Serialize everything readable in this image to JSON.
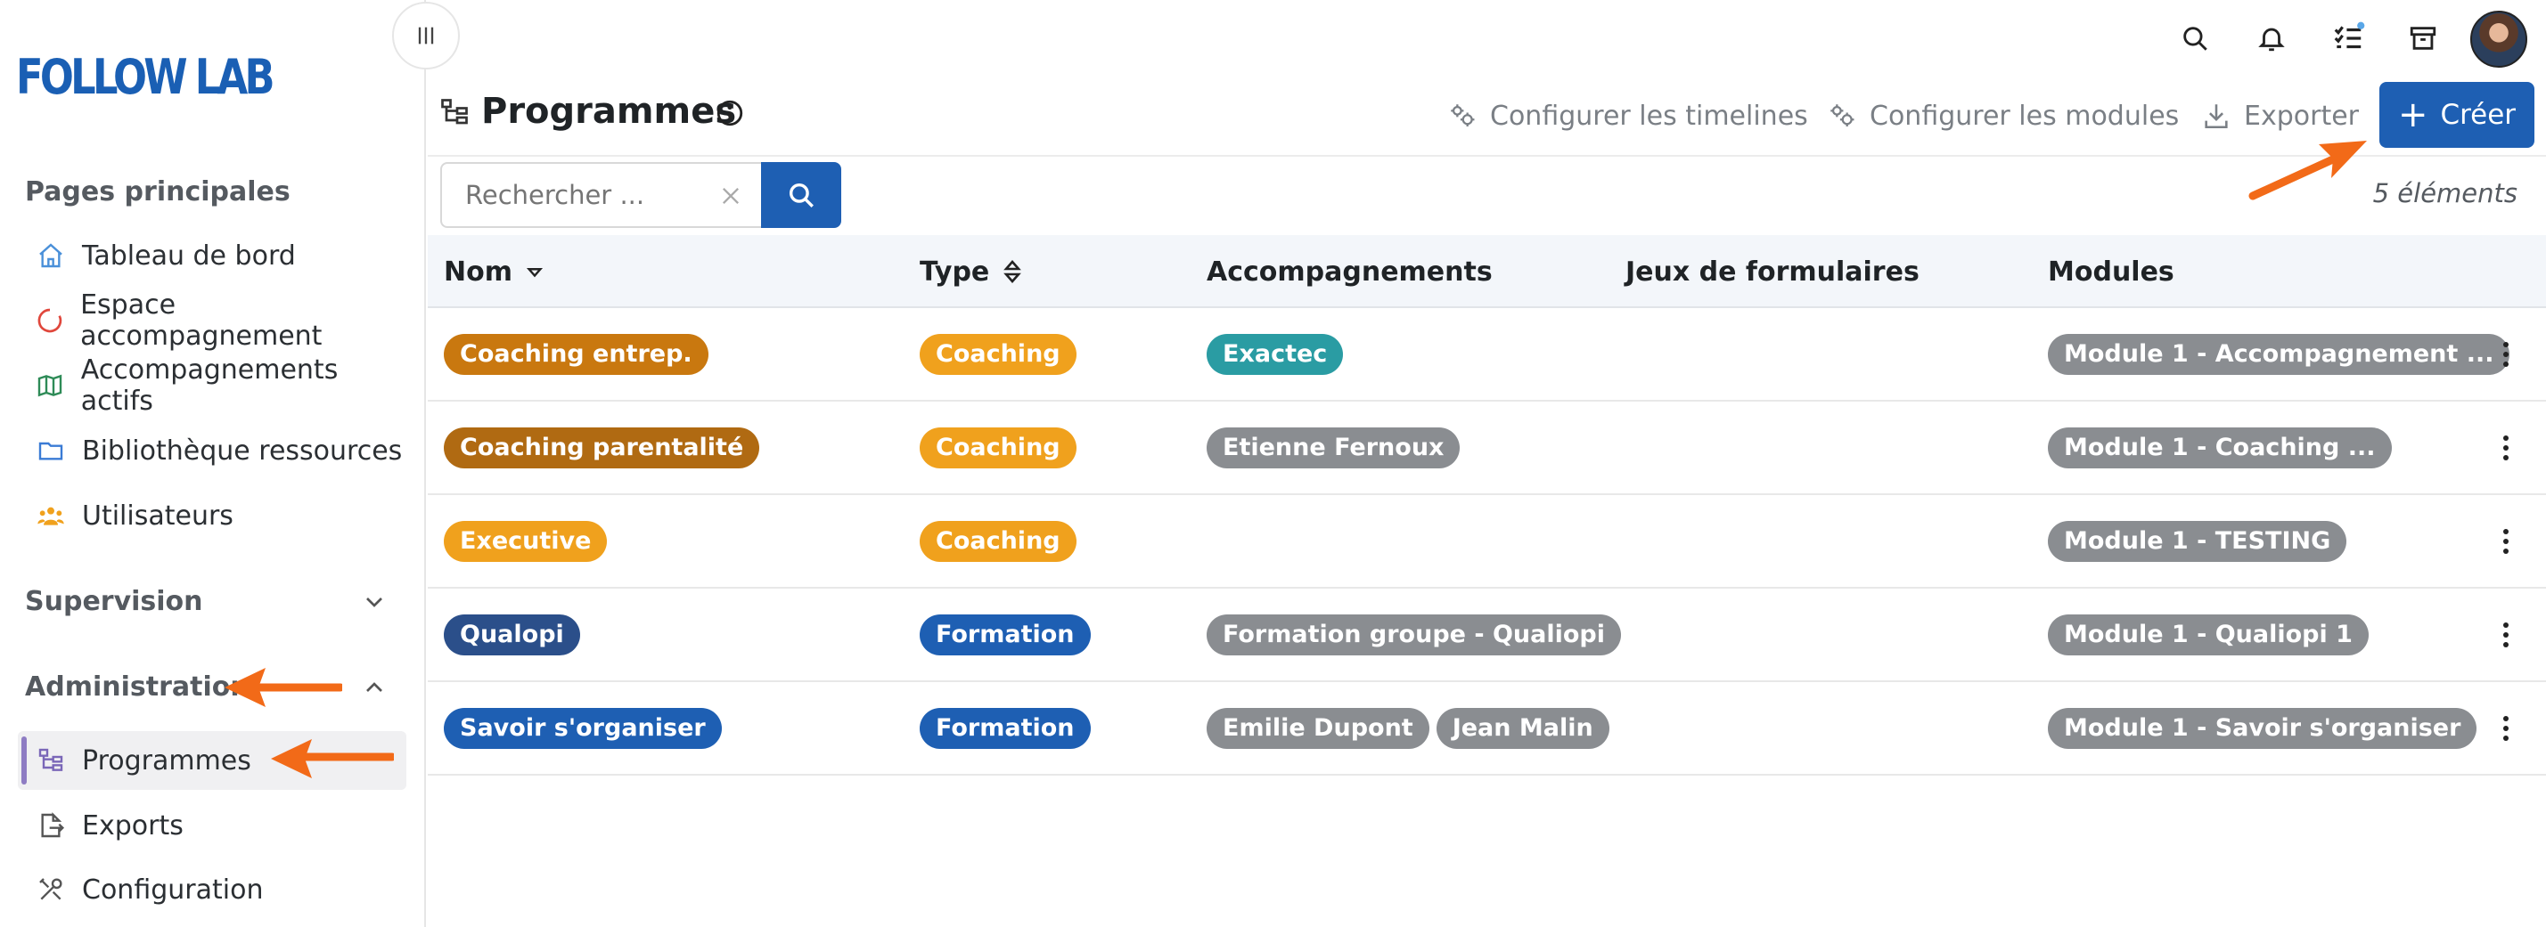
{
  "brand": {
    "logo_text": "FOLLOW LAB",
    "color": "#1a5fb4"
  },
  "sidebar": {
    "sections": [
      {
        "title": "Pages principales"
      },
      {
        "title": "Supervision"
      },
      {
        "title": "Administration"
      }
    ],
    "main_items": [
      {
        "label": "Tableau de bord",
        "icon": "home-icon"
      },
      {
        "label": "Espace accompagnement",
        "icon": "circle-icon"
      },
      {
        "label": "Accompagnements actifs",
        "icon": "map-icon"
      },
      {
        "label": "Bibliothèque ressources",
        "icon": "folder-icon"
      },
      {
        "label": "Utilisateurs",
        "icon": "users-icon"
      }
    ],
    "admin_items": [
      {
        "label": "Programmes",
        "icon": "tree-icon",
        "active": true
      },
      {
        "label": "Exports",
        "icon": "export-icon"
      },
      {
        "label": "Configuration",
        "icon": "tools-icon"
      }
    ]
  },
  "header": {
    "title": "Programmes",
    "actions": {
      "timelines": "Configurer les timelines",
      "modules": "Configurer les modules",
      "export": "Exporter",
      "create": "Créer"
    }
  },
  "search": {
    "placeholder": "Rechercher ...",
    "count": "5 éléments"
  },
  "table": {
    "columns": [
      "Nom",
      "Type",
      "Accompagnements",
      "Jeux de formulaires",
      "Modules"
    ],
    "rows": [
      {
        "nom": "Coaching entrep.",
        "nom_color": "#c9780f",
        "type": "Coaching",
        "type_color": "#f0a11d",
        "accomps": [
          {
            "label": "Exactec",
            "color": "#2a9ca3"
          }
        ],
        "module": "Module 1 - Accompagnement ..."
      },
      {
        "nom": "Coaching parentalité",
        "nom_color": "#b06a12",
        "type": "Coaching",
        "type_color": "#f0a11d",
        "accomps": [
          {
            "label": "Etienne Fernoux",
            "color": "#8a8d91"
          }
        ],
        "module": "Module 1 - Coaching ..."
      },
      {
        "nom": "Executive",
        "nom_color": "#f0a11d",
        "type": "Coaching",
        "type_color": "#f0a11d",
        "accomps": [],
        "module": "Module 1 - TESTING"
      },
      {
        "nom": "Qualopi",
        "nom_color": "#2b4f8a",
        "type": "Formation",
        "type_color": "#1e5fb3",
        "accomps": [
          {
            "label": "Formation groupe - Qualiopi",
            "color": "#8a8d91"
          }
        ],
        "module": "Module 1 - Qualiopi 1"
      },
      {
        "nom": "Savoir s'organiser",
        "nom_color": "#1e5fb3",
        "type": "Formation",
        "type_color": "#1e5fb3",
        "accomps": [
          {
            "label": "Emilie Dupont",
            "color": "#8a8d91"
          },
          {
            "label": "Jean Malin",
            "color": "#8a8d91"
          }
        ],
        "module": "Module 1 - Savoir s'organiser"
      }
    ]
  },
  "colors": {
    "primary": "#1e5fb3",
    "arrow": "#f26a18",
    "module_pill": "#8a8d91"
  }
}
